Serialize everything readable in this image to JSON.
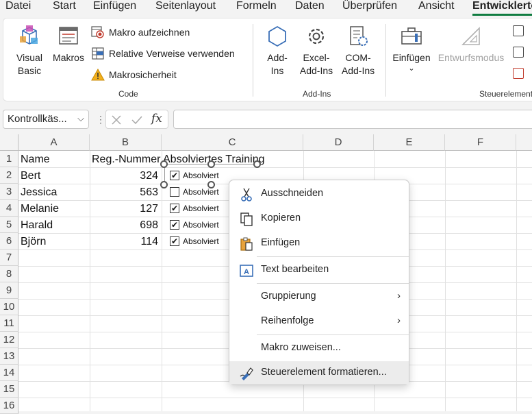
{
  "tabs": [
    "Datei",
    "Start",
    "Einfügen",
    "Seitenlayout",
    "Formeln",
    "Daten",
    "Überprüfen",
    "Ansicht",
    "Entwicklertools"
  ],
  "ribbon": {
    "code": {
      "visual_basic": "Visual\nBasic",
      "makros": "Makros",
      "record_macro": "Makro aufzeichnen",
      "relative_refs": "Relative Verweise verwenden",
      "macro_security": "Makrosicherheit",
      "label": "Code"
    },
    "addins": {
      "addins": "Add-\nIns",
      "excel_addins": "Excel-\nAdd-Ins",
      "com_addins": "COM-\nAdd-Ins",
      "label": "Add-Ins"
    },
    "controls": {
      "insert": "Einfügen",
      "design_mode": "Entwurfsmodus",
      "label": "Steuerelemente"
    }
  },
  "formula_bar": {
    "name_box": "Kontrollkäs...",
    "fx": "fx",
    "value": ""
  },
  "columns": [
    "A",
    "B",
    "C",
    "D",
    "E",
    "F"
  ],
  "rows": [
    "1",
    "2",
    "3",
    "4",
    "5",
    "6",
    "7",
    "8",
    "9",
    "10",
    "11",
    "12",
    "13",
    "14",
    "15",
    "16"
  ],
  "table": {
    "headers": [
      "Name",
      "Reg.-Nummer",
      "Absolviertes Training"
    ],
    "data": [
      {
        "name": "Bert",
        "reg": "324",
        "checked": true,
        "label": "Absolviert"
      },
      {
        "name": "Jessica",
        "reg": "563",
        "checked": false,
        "label": "Absolviert"
      },
      {
        "name": "Melanie",
        "reg": "127",
        "checked": true,
        "label": "Absolviert"
      },
      {
        "name": "Harald",
        "reg": "698",
        "checked": true,
        "label": "Absolviert"
      },
      {
        "name": "Björn",
        "reg": "114",
        "checked": true,
        "label": "Absolviert"
      }
    ]
  },
  "context_menu": {
    "cut": "Ausschneiden",
    "copy": "Kopieren",
    "paste": "Einfügen",
    "edit_text": "Text bearbeiten",
    "grouping": "Gruppierung",
    "order": "Reihenfolge",
    "assign_macro": "Makro zuweisen...",
    "format_control": "Steuerelement formatieren..."
  },
  "colors": {
    "accent": "#107c41",
    "window_bg": "#f3f3f3"
  }
}
